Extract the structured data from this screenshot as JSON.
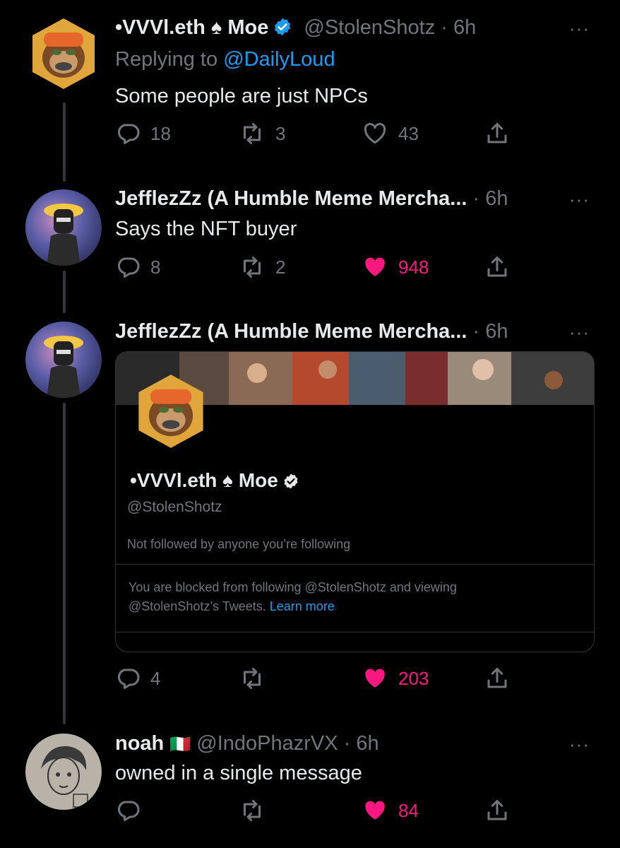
{
  "tweets": [
    {
      "display_name": "•VVVl.eth ♠ Moe",
      "verified": true,
      "handle": "@StolenShotz",
      "time": "· 6h",
      "replying_prefix": "Replying to",
      "replying_handle": "@DailyLoud",
      "text": "Some people are just NPCs",
      "replies": "18",
      "retweets": "3",
      "likes": "43",
      "liked": false
    },
    {
      "display_name": "JefflezZz (A Humble Meme Mercha...",
      "time": "· 6h",
      "text": "Says the NFT buyer",
      "replies": "8",
      "retweets": "2",
      "likes": "948",
      "liked": true
    },
    {
      "display_name": "JefflezZz (A Humble Meme Mercha...",
      "time": "· 6h",
      "replies": "4",
      "retweets": "",
      "likes": "203",
      "liked": true,
      "card": {
        "name": "•VVVl.eth ♠ Moe",
        "handle": "@StolenShotz",
        "note": "Not followed by anyone you’re following",
        "blocked_text": "You are blocked from following @StolenShotz and viewing @StolenShotz’s Tweets.",
        "learn_more": "Learn more"
      }
    },
    {
      "display_name": "noah",
      "flag": "🇮🇹",
      "handle": "@IndoPhazrVX",
      "time": "· 6h",
      "text": "owned in a single message",
      "replies": "",
      "retweets": "",
      "likes": "84",
      "liked": true
    }
  ],
  "more_label": "···",
  "colors": {
    "background": "#000000",
    "text": "#e7e9ea",
    "muted": "#71767b",
    "accent_blue": "#1d9bf0",
    "like_pink": "#f91880"
  },
  "icons": [
    "reply-icon",
    "retweet-icon",
    "like-icon",
    "share-icon",
    "verified-icon",
    "more-icon"
  ]
}
